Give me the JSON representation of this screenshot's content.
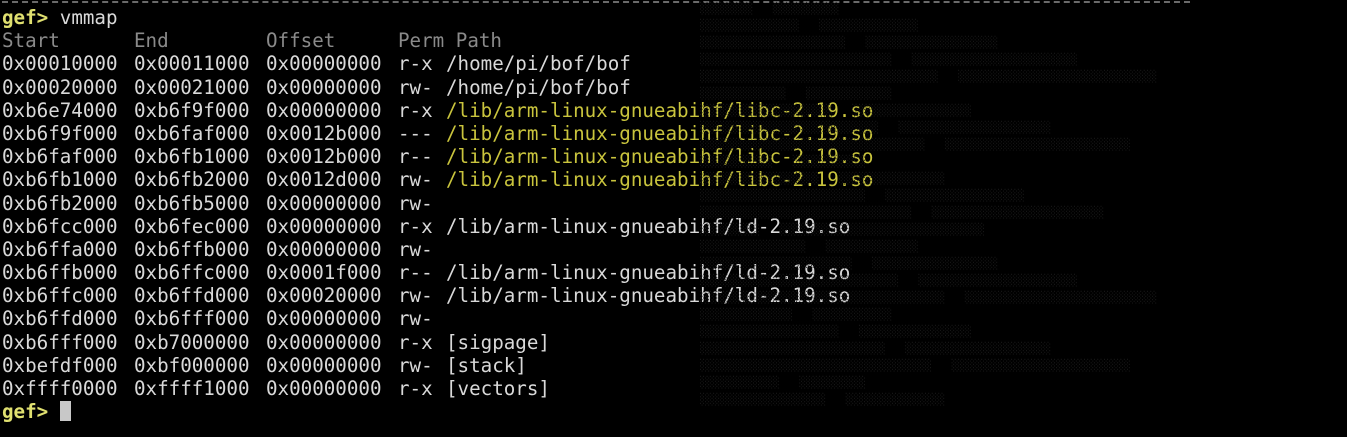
{
  "terminal": {
    "prompt": "gef>",
    "command": "vmmap",
    "headers": {
      "start": "Start",
      "end": "End",
      "offset": "Offset",
      "perm": "Perm",
      "path": "Path"
    },
    "rows": [
      {
        "start": "0x00010000",
        "end": "0x00011000",
        "offset": "0x00000000",
        "perm": "r-x",
        "path": "/home/pi/bof/bof",
        "highlight": false
      },
      {
        "start": "0x00020000",
        "end": "0x00021000",
        "offset": "0x00000000",
        "perm": "rw-",
        "path": "/home/pi/bof/bof",
        "highlight": false
      },
      {
        "start": "0xb6e74000",
        "end": "0xb6f9f000",
        "offset": "0x00000000",
        "perm": "r-x",
        "path": "/lib/arm-linux-gnueabihf/libc-2.19.so",
        "highlight": true
      },
      {
        "start": "0xb6f9f000",
        "end": "0xb6faf000",
        "offset": "0x0012b000",
        "perm": "---",
        "path": "/lib/arm-linux-gnueabihf/libc-2.19.so",
        "highlight": true
      },
      {
        "start": "0xb6faf000",
        "end": "0xb6fb1000",
        "offset": "0x0012b000",
        "perm": "r--",
        "path": "/lib/arm-linux-gnueabihf/libc-2.19.so",
        "highlight": true
      },
      {
        "start": "0xb6fb1000",
        "end": "0xb6fb2000",
        "offset": "0x0012d000",
        "perm": "rw-",
        "path": "/lib/arm-linux-gnueabihf/libc-2.19.so",
        "highlight": true
      },
      {
        "start": "0xb6fb2000",
        "end": "0xb6fb5000",
        "offset": "0x00000000",
        "perm": "rw-",
        "path": "",
        "highlight": false
      },
      {
        "start": "0xb6fcc000",
        "end": "0xb6fec000",
        "offset": "0x00000000",
        "perm": "r-x",
        "path": "/lib/arm-linux-gnueabihf/ld-2.19.so",
        "highlight": false
      },
      {
        "start": "0xb6ffa000",
        "end": "0xb6ffb000",
        "offset": "0x00000000",
        "perm": "rw-",
        "path": "",
        "highlight": false
      },
      {
        "start": "0xb6ffb000",
        "end": "0xb6ffc000",
        "offset": "0x0001f000",
        "perm": "r--",
        "path": "/lib/arm-linux-gnueabihf/ld-2.19.so",
        "highlight": false
      },
      {
        "start": "0xb6ffc000",
        "end": "0xb6ffd000",
        "offset": "0x00020000",
        "perm": "rw-",
        "path": "/lib/arm-linux-gnueabihf/ld-2.19.so",
        "highlight": false
      },
      {
        "start": "0xb6ffd000",
        "end": "0xb6fff000",
        "offset": "0x00000000",
        "perm": "rw-",
        "path": "",
        "highlight": false
      },
      {
        "start": "0xb6fff000",
        "end": "0xb7000000",
        "offset": "0x00000000",
        "perm": "r-x",
        "path": "[sigpage]",
        "highlight": false
      },
      {
        "start": "0xbefdf000",
        "end": "0xbf000000",
        "offset": "0x00000000",
        "perm": "rw-",
        "path": "[stack]",
        "highlight": false
      },
      {
        "start": "0xffff0000",
        "end": "0xffff1000",
        "offset": "0x00000000",
        "perm": "r-x",
        "path": "[vectors]",
        "highlight": false
      }
    ]
  },
  "colors": {
    "background": "#000000",
    "text": "#d9d9d9",
    "prompt": "#e0e070",
    "header": "#8a8a8a",
    "lib_path": "#c9c43d"
  }
}
